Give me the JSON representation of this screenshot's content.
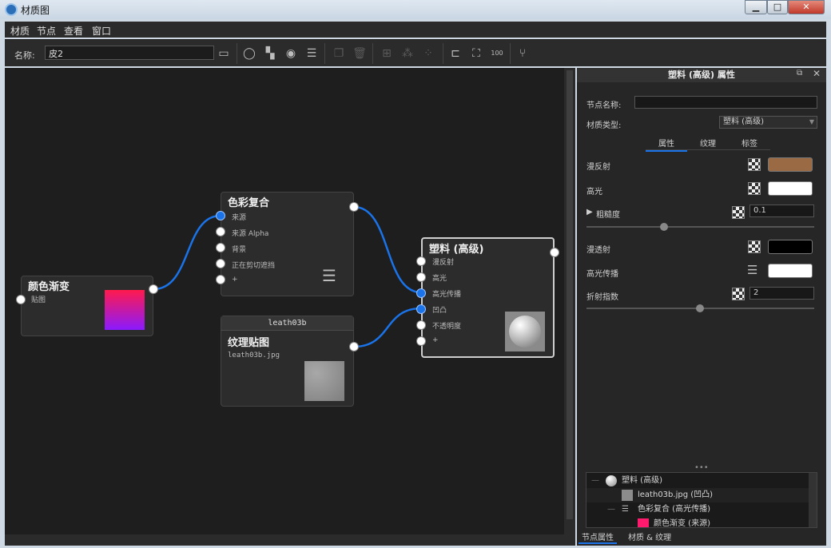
{
  "window": {
    "title": "材质图",
    "buttons": {
      "minimize": "▁",
      "maximize": "□",
      "close": "✕"
    }
  },
  "menu": [
    "材质",
    "节点",
    "查看",
    "窗口"
  ],
  "toolbar": {
    "name_label": "名称:",
    "name_value": "皮2"
  },
  "nodes": {
    "gradient": {
      "title": "颜色渐变",
      "slots": [
        "贴图"
      ],
      "colors": [
        "#ff1a4d",
        "#8a1aff"
      ]
    },
    "composite": {
      "title": "色彩复合",
      "slots": [
        "来源",
        "来源 Alpha",
        "背景",
        "正在剪切遮挡",
        "+"
      ]
    },
    "texture": {
      "header": "leath03b",
      "title": "纹理贴图",
      "file": "leath03b.jpg"
    },
    "plastic": {
      "title": "塑料 (高级)",
      "slots": [
        "漫反射",
        "高光",
        "高光传播",
        "凹凸",
        "不透明度",
        "+"
      ]
    }
  },
  "panel": {
    "header": "塑料 (高级) 属性",
    "node_name_label": "节点名称:",
    "node_name_value": "",
    "material_type_label": "材质类型:",
    "material_type_value": "塑料 (高级)",
    "tabs": [
      "属性",
      "纹理",
      "标签"
    ],
    "props": {
      "diffuse": {
        "label": "漫反射",
        "color": "#9a6a44"
      },
      "specular": {
        "label": "高光",
        "color": "#ffffff"
      },
      "roughness": {
        "label": "粗糙度",
        "value": "0.1"
      },
      "transmission": {
        "label": "漫透射",
        "color": "#000000"
      },
      "spec_spread": {
        "label": "高光传播",
        "color": "#ffffff"
      },
      "ior": {
        "label": "折射指数",
        "value": "2"
      }
    },
    "tree": [
      "塑料 (高级)",
      "leath03b.jpg (凹凸)",
      "色彩复合 (高光传播)",
      "颜色渐变 (来源)"
    ],
    "bottom_tabs": [
      "节点属性",
      "材质 & 纹理"
    ]
  }
}
